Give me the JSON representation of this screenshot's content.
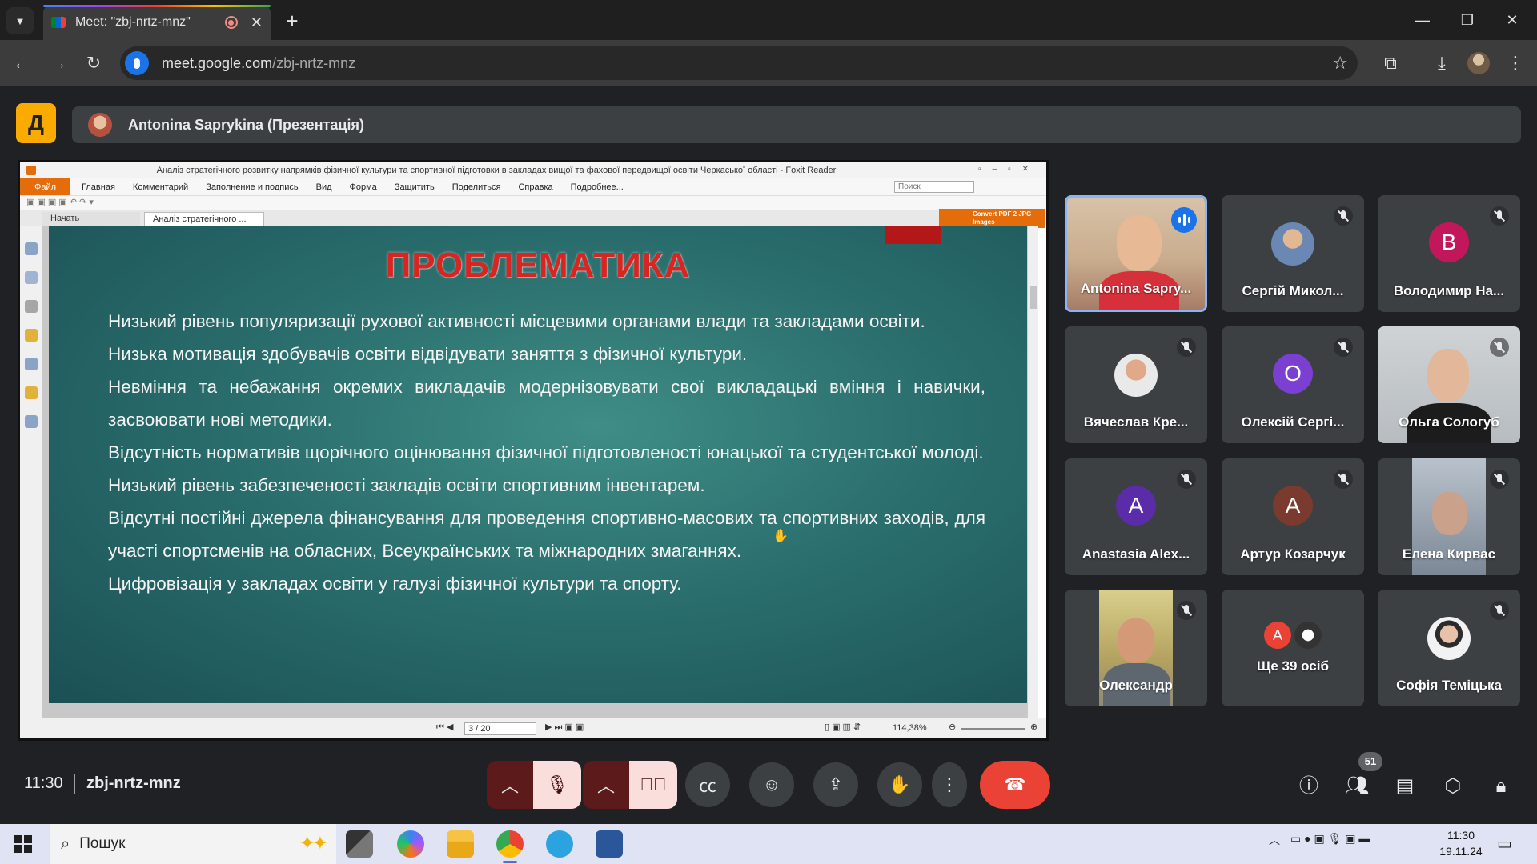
{
  "browser": {
    "tab_title": "Meet: \"zbj-nrtz-mnz\"",
    "tab_close": "✕",
    "new_tab": "+",
    "url_host": "meet.google.com",
    "url_path": "/zbj-nrtz-mnz"
  },
  "meet": {
    "presenter_banner": "Antonina Saprykina (Презентація)",
    "time": "11:30",
    "meeting_code": "zbj-nrtz-mnz",
    "participants_badge": "51"
  },
  "foxit": {
    "window_title": "Аналіз стратегічного розвитку напрямків фізичної культури та спортивної підготовки в закладах вищої та фахової передвищої освіти Черкаської області - Foxit Reader",
    "menu": [
      "Файл",
      "Главная",
      "Комментарий",
      "Заполнение и подпись",
      "Вид",
      "Форма",
      "Защитить",
      "Поделиться",
      "Справка",
      "Подробнее..."
    ],
    "search_placeholder": "Поиск",
    "tabs": [
      "Начать",
      "Аналіз стратегічного ..."
    ],
    "convert_label": "Convert PDF 2 JPG Images",
    "page_indicator": "3 / 20",
    "zoom": "114,38%"
  },
  "slide": {
    "title": "ПРОБЛЕМАТИКА",
    "paragraphs": [
      "Низький рівень популяризації рухової активності місцевими органами влади та закладами освіти.",
      "Низька мотивація здобувачів освіти відвідувати заняття з фізичної культури.",
      "Невміння та небажання окремих викладачів модернізовувати свої викладацькі вміння і навички, засвоювати нові методики.",
      "Відсутність нормативів щорічного оцінювання фізичної підготовленості юнацької та студентської молоді.",
      "Низький рівень забезпеченості закладів освіти спортивним інвентарем.",
      "Відсутні постійні джерела фінансування для проведення спортивно-масових та спортивних заходів, для участі спортсменів на обласних, Всеукраїнських та міжнародних змаганнях.",
      "Цифровізація у закладах освіти у галузі фізичної культури та спорту."
    ]
  },
  "participants": [
    {
      "name": "Antonina Sapry...",
      "type": "video",
      "speaking": true
    },
    {
      "name": "Сергій Микол...",
      "type": "photo"
    },
    {
      "name": "Володимир На...",
      "type": "letter",
      "letter": "В",
      "color": "#c2185b"
    },
    {
      "name": "Вячеслав Кре...",
      "type": "photo"
    },
    {
      "name": "Олексій Сергі...",
      "type": "letter",
      "letter": "О",
      "color": "#7b3fd1"
    },
    {
      "name": "Ольга Сологуб",
      "type": "video"
    },
    {
      "name": "Anastasia Alex...",
      "type": "letter",
      "letter": "A",
      "color": "#5b2ca8"
    },
    {
      "name": "Артур Козарчук",
      "type": "letter",
      "letter": "А",
      "color": "#7a3a2e"
    },
    {
      "name": "Елена Кирвас",
      "type": "video"
    },
    {
      "name": "Олександр",
      "type": "video"
    },
    {
      "name": "Ще 39 осіб",
      "type": "more",
      "letter": "А"
    },
    {
      "name": "Софія Теміцька",
      "type": "photo"
    }
  ],
  "taskbar": {
    "search_placeholder": "Пошук",
    "clock_time": "11:30",
    "clock_date": "19.11.24"
  },
  "colors": {
    "meet_bg": "#202124",
    "tile_bg": "#3c4043",
    "leave_red": "#ea4335",
    "slide_title_red": "#d9241f",
    "foxit_orange": "#e46c0a",
    "active_border": "#8ab4f8"
  }
}
